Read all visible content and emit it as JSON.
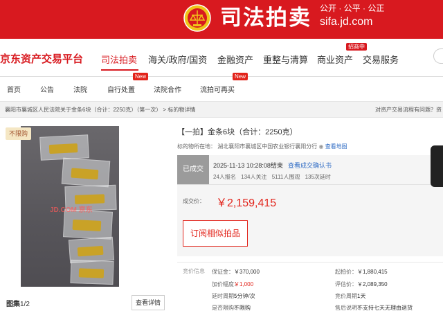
{
  "banner": {
    "title": "司法拍卖",
    "slogan": "公开 · 公平 · 公正",
    "domain": "sifa.jd.com"
  },
  "nav": {
    "logo": "京东资产交易平台",
    "items": [
      "司法拍卖",
      "海关/政府/国资",
      "金融资产",
      "重整与清算",
      "商业资产",
      "交易服务"
    ],
    "badge": "招商中"
  },
  "subnav": {
    "items": [
      "首页",
      "公告",
      "法院",
      "自行处置",
      "法院合作",
      "流拍可再买"
    ],
    "new_tag": "New"
  },
  "breadcrumb": {
    "path": "襄阳市襄城区人民法院关于金条6块（合计：2250克）（第一次） > 标的物详情",
    "right": "对资产交易流程有问题？资"
  },
  "gallery": {
    "tag": "不限购",
    "watermark": "JD.COM 京东",
    "pic_label": "图集",
    "pic_index": "1/2",
    "detail_button": "查看详情"
  },
  "lot": {
    "title": "【一拍】金条6块（合计：2250克）",
    "location_label": "标的物所在地：",
    "location": "湖北襄阳市襄城区中国农业银行襄阳分行",
    "map_link": "查看地图"
  },
  "status": {
    "badge": "已成交",
    "end_time": "2025-11-13 10:28:08结束",
    "confirm_link": "查看成交确认书",
    "signups": "24人报名",
    "follows": "134人关注",
    "views": "5111人围观",
    "delays": "135次延时",
    "price_label": "成交价：",
    "price": "￥2,159,415",
    "subscribe_button": "订阅相似拍品"
  },
  "terms": {
    "heading": "竞价信息",
    "rows": [
      {
        "k1": "保证金：",
        "v1": "￥370,000",
        "k2": "起拍价：",
        "v2": "￥1,880,415"
      },
      {
        "k1": "加价幅度：",
        "v1": "￥1,000",
        "k2": "评估价：",
        "v2": "￥2,089,350"
      },
      {
        "k1": "延时周期：",
        "v1": "5分钟/次",
        "k2": "竞价周期：",
        "v2": "1天"
      },
      {
        "k1": "是否限购：",
        "v1": "不限购",
        "k2": "售后说明：",
        "v2": "不支持七天无理由退货"
      }
    ]
  },
  "colors": {
    "brand_red": "#d8191f",
    "price_red": "#e2231a",
    "link_blue": "#2e6bc4"
  }
}
